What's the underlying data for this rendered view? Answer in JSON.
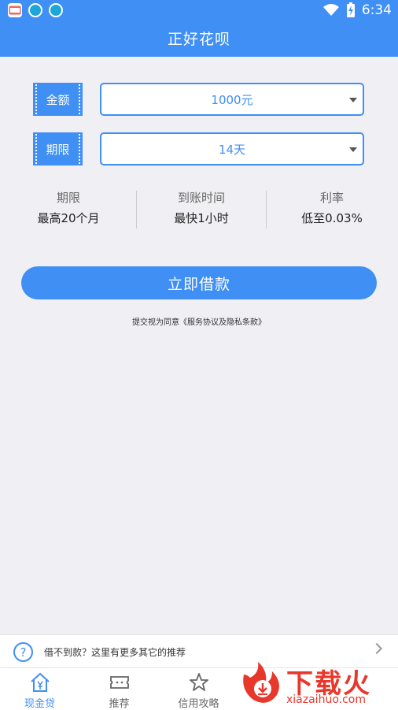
{
  "status_bar": {
    "time": "6:34"
  },
  "header": {
    "title": "正好花呗"
  },
  "form": {
    "amount": {
      "label": "金额",
      "value": "1000元"
    },
    "term": {
      "label": "期限",
      "value": "14天"
    }
  },
  "stats": [
    {
      "label": "期限",
      "value": "最高20个月"
    },
    {
      "label": "到账时间",
      "value": "最快1小时"
    },
    {
      "label": "利率",
      "value": "低至0.03%"
    }
  ],
  "cta": {
    "label": "立即借款"
  },
  "agreement": {
    "text": "提交视为同意《服务协议及隐私条款》"
  },
  "recommend_bar": {
    "text": "借不到款？这里有更多其它的推荐"
  },
  "tabs": [
    {
      "label": "现金贷",
      "icon": "home-yuan-icon",
      "active": true
    },
    {
      "label": "推荐",
      "icon": "ticket-icon",
      "active": false
    },
    {
      "label": "信用攻略",
      "icon": "star-icon",
      "active": false
    }
  ],
  "watermark": {
    "title": "下载火",
    "url": "xiazaihuo.com"
  },
  "colors": {
    "primary": "#3f8ff5",
    "background": "#efeff4",
    "watermark": "#e8372b"
  }
}
